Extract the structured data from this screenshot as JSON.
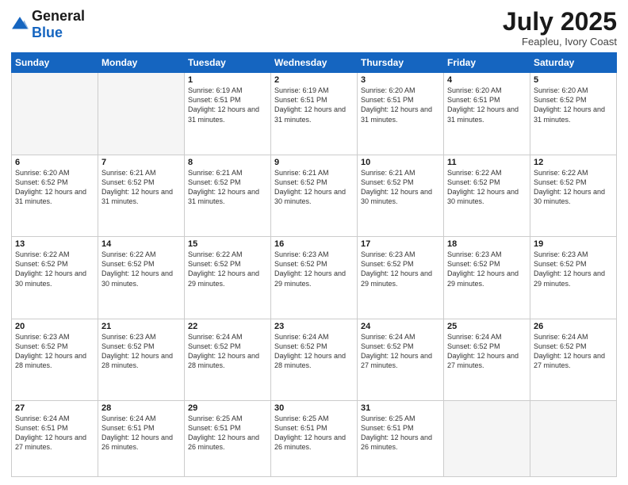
{
  "header": {
    "logo_general": "General",
    "logo_blue": "Blue",
    "month_year": "July 2025",
    "location": "Feapleu, Ivory Coast"
  },
  "weekdays": [
    "Sunday",
    "Monday",
    "Tuesday",
    "Wednesday",
    "Thursday",
    "Friday",
    "Saturday"
  ],
  "rows": [
    [
      {
        "day": "",
        "info": ""
      },
      {
        "day": "",
        "info": ""
      },
      {
        "day": "1",
        "info": "Sunrise: 6:19 AM\nSunset: 6:51 PM\nDaylight: 12 hours and 31 minutes."
      },
      {
        "day": "2",
        "info": "Sunrise: 6:19 AM\nSunset: 6:51 PM\nDaylight: 12 hours and 31 minutes."
      },
      {
        "day": "3",
        "info": "Sunrise: 6:20 AM\nSunset: 6:51 PM\nDaylight: 12 hours and 31 minutes."
      },
      {
        "day": "4",
        "info": "Sunrise: 6:20 AM\nSunset: 6:51 PM\nDaylight: 12 hours and 31 minutes."
      },
      {
        "day": "5",
        "info": "Sunrise: 6:20 AM\nSunset: 6:52 PM\nDaylight: 12 hours and 31 minutes."
      }
    ],
    [
      {
        "day": "6",
        "info": "Sunrise: 6:20 AM\nSunset: 6:52 PM\nDaylight: 12 hours and 31 minutes."
      },
      {
        "day": "7",
        "info": "Sunrise: 6:21 AM\nSunset: 6:52 PM\nDaylight: 12 hours and 31 minutes."
      },
      {
        "day": "8",
        "info": "Sunrise: 6:21 AM\nSunset: 6:52 PM\nDaylight: 12 hours and 31 minutes."
      },
      {
        "day": "9",
        "info": "Sunrise: 6:21 AM\nSunset: 6:52 PM\nDaylight: 12 hours and 30 minutes."
      },
      {
        "day": "10",
        "info": "Sunrise: 6:21 AM\nSunset: 6:52 PM\nDaylight: 12 hours and 30 minutes."
      },
      {
        "day": "11",
        "info": "Sunrise: 6:22 AM\nSunset: 6:52 PM\nDaylight: 12 hours and 30 minutes."
      },
      {
        "day": "12",
        "info": "Sunrise: 6:22 AM\nSunset: 6:52 PM\nDaylight: 12 hours and 30 minutes."
      }
    ],
    [
      {
        "day": "13",
        "info": "Sunrise: 6:22 AM\nSunset: 6:52 PM\nDaylight: 12 hours and 30 minutes."
      },
      {
        "day": "14",
        "info": "Sunrise: 6:22 AM\nSunset: 6:52 PM\nDaylight: 12 hours and 30 minutes."
      },
      {
        "day": "15",
        "info": "Sunrise: 6:22 AM\nSunset: 6:52 PM\nDaylight: 12 hours and 29 minutes."
      },
      {
        "day": "16",
        "info": "Sunrise: 6:23 AM\nSunset: 6:52 PM\nDaylight: 12 hours and 29 minutes."
      },
      {
        "day": "17",
        "info": "Sunrise: 6:23 AM\nSunset: 6:52 PM\nDaylight: 12 hours and 29 minutes."
      },
      {
        "day": "18",
        "info": "Sunrise: 6:23 AM\nSunset: 6:52 PM\nDaylight: 12 hours and 29 minutes."
      },
      {
        "day": "19",
        "info": "Sunrise: 6:23 AM\nSunset: 6:52 PM\nDaylight: 12 hours and 29 minutes."
      }
    ],
    [
      {
        "day": "20",
        "info": "Sunrise: 6:23 AM\nSunset: 6:52 PM\nDaylight: 12 hours and 28 minutes."
      },
      {
        "day": "21",
        "info": "Sunrise: 6:23 AM\nSunset: 6:52 PM\nDaylight: 12 hours and 28 minutes."
      },
      {
        "day": "22",
        "info": "Sunrise: 6:24 AM\nSunset: 6:52 PM\nDaylight: 12 hours and 28 minutes."
      },
      {
        "day": "23",
        "info": "Sunrise: 6:24 AM\nSunset: 6:52 PM\nDaylight: 12 hours and 28 minutes."
      },
      {
        "day": "24",
        "info": "Sunrise: 6:24 AM\nSunset: 6:52 PM\nDaylight: 12 hours and 27 minutes."
      },
      {
        "day": "25",
        "info": "Sunrise: 6:24 AM\nSunset: 6:52 PM\nDaylight: 12 hours and 27 minutes."
      },
      {
        "day": "26",
        "info": "Sunrise: 6:24 AM\nSunset: 6:52 PM\nDaylight: 12 hours and 27 minutes."
      }
    ],
    [
      {
        "day": "27",
        "info": "Sunrise: 6:24 AM\nSunset: 6:51 PM\nDaylight: 12 hours and 27 minutes."
      },
      {
        "day": "28",
        "info": "Sunrise: 6:24 AM\nSunset: 6:51 PM\nDaylight: 12 hours and 26 minutes."
      },
      {
        "day": "29",
        "info": "Sunrise: 6:25 AM\nSunset: 6:51 PM\nDaylight: 12 hours and 26 minutes."
      },
      {
        "day": "30",
        "info": "Sunrise: 6:25 AM\nSunset: 6:51 PM\nDaylight: 12 hours and 26 minutes."
      },
      {
        "day": "31",
        "info": "Sunrise: 6:25 AM\nSunset: 6:51 PM\nDaylight: 12 hours and 26 minutes."
      },
      {
        "day": "",
        "info": ""
      },
      {
        "day": "",
        "info": ""
      }
    ]
  ]
}
